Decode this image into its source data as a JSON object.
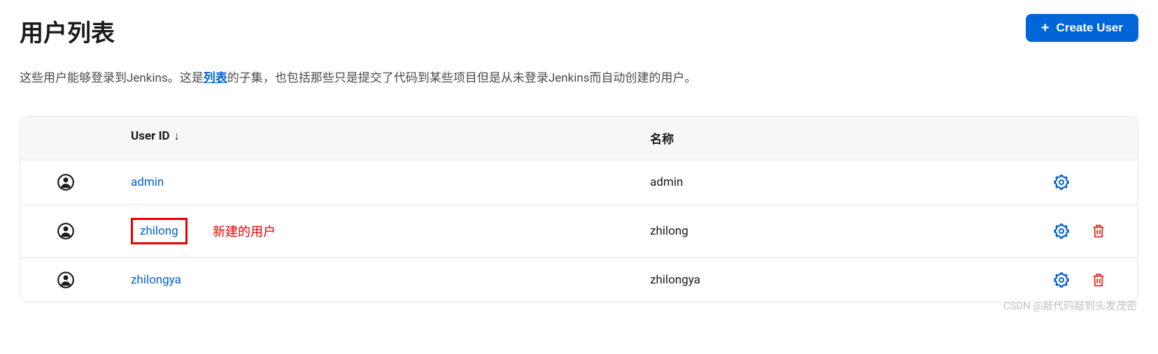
{
  "header": {
    "title": "用户列表",
    "create_button": "Create User"
  },
  "description": {
    "text_before": "这些用户能够登录到Jenkins。这是",
    "link_text": "列表",
    "text_after": "的子集，也包括那些只是提交了代码到某些项目但是从未登录Jenkins而自动创建的用户。"
  },
  "table": {
    "columns": {
      "user_id": "User ID",
      "sort_indicator": "↓",
      "name": "名称"
    },
    "rows": [
      {
        "user_id": "admin",
        "name": "admin",
        "highlighted": false,
        "annotation": "",
        "has_delete": false
      },
      {
        "user_id": "zhilong",
        "name": "zhilong",
        "highlighted": true,
        "annotation": "新建的用户",
        "has_delete": true
      },
      {
        "user_id": "zhilongya",
        "name": "zhilongya",
        "highlighted": false,
        "annotation": "",
        "has_delete": true
      }
    ]
  },
  "watermark": "CSDN @敲代码敲到头发茂密"
}
